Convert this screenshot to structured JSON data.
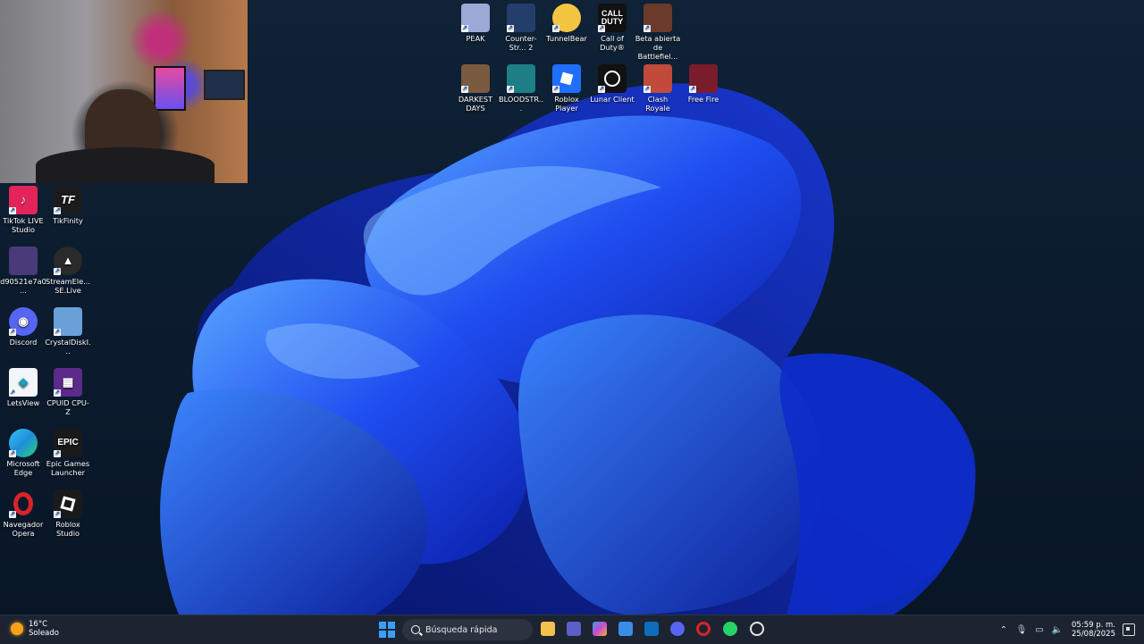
{
  "desktop_icons_top": [
    {
      "label": "PEAK",
      "icon": "peak-icon",
      "color": "#9aa9d6"
    },
    {
      "label": "Counter-Str... 2",
      "icon": "counter-strike-icon",
      "color": "#233e6b"
    },
    {
      "label": "TunnelBear",
      "icon": "tunnelbear-icon",
      "color": "#f4c542"
    },
    {
      "label": "Call of Duty®",
      "icon": "call-of-duty-icon",
      "color": "#111111"
    },
    {
      "label": "Beta abierta de Battlefiel...",
      "icon": "battlefield-icon",
      "color": "#6b3a2a"
    },
    {
      "label": "DARKEST DAYS",
      "icon": "darkest-days-icon",
      "color": "#7a5a40"
    },
    {
      "label": "BLOODSTR...",
      "icon": "bloodstrike-icon",
      "color": "#1d7f86"
    },
    {
      "label": "Roblox Player",
      "icon": "roblox-player-icon",
      "color": "#1f6fff"
    },
    {
      "label": "Lunar Client",
      "icon": "lunar-client-icon",
      "color": "#111111"
    },
    {
      "label": "Clash Royale",
      "icon": "clash-royale-icon",
      "color": "#c24a3a"
    },
    {
      "label": "Free Fire",
      "icon": "free-fire-icon",
      "color": "#7a1d2a"
    }
  ],
  "desktop_icons_left": [
    {
      "label": "TikTok LIVE Studio",
      "icon": "tiktok-live-icon",
      "color": "#e3245a"
    },
    {
      "label": "TikFinity",
      "icon": "tikfinity-icon",
      "color": "#1b1b1b"
    },
    {
      "label": "d90521e7a0...",
      "icon": "image-file-icon",
      "color": "#4a3a7a"
    },
    {
      "label": "StreamEle... SE.Live",
      "icon": "streamelements-icon",
      "color": "#2a2a2a"
    },
    {
      "label": "Discord",
      "icon": "discord-icon",
      "color": "#5865f2"
    },
    {
      "label": "CrystalDiskI...",
      "icon": "crystaldiskinfo-icon",
      "color": "#6aa0d8"
    },
    {
      "label": "LetsView",
      "icon": "letsview-icon",
      "color": "#f2f6fa"
    },
    {
      "label": "CPUID CPU-Z",
      "icon": "cpuz-icon",
      "color": "#5b2a8a"
    },
    {
      "label": "Microsoft Edge",
      "icon": "edge-icon",
      "color": "#1e8fd8"
    },
    {
      "label": "Epic Games Launcher",
      "icon": "epic-games-icon",
      "color": "#1a1a1a"
    },
    {
      "label": "Navegador Opera",
      "icon": "opera-icon",
      "color": "#d8232a"
    },
    {
      "label": "Roblox Studio",
      "icon": "roblox-studio-icon",
      "color": "#1a1a1a"
    }
  ],
  "icon_glyphs": {
    "call_of_duty": "CALL DUTY",
    "epic": "EPIC",
    "tikfinity": "TF"
  },
  "taskbar": {
    "weather_temp": "16°C",
    "weather_desc": "Soleado",
    "search_placeholder": "Búsqueda rápida",
    "time": "05:59 p. m.",
    "date": "25/08/2025",
    "apps": [
      {
        "icon": "file-explorer-icon",
        "color": "#f2c14e"
      },
      {
        "icon": "teams-icon",
        "color": "#5b5fc7"
      },
      {
        "icon": "copilot-icon",
        "color": "#35a0e8"
      },
      {
        "icon": "store-icon",
        "color": "#3a8ee6"
      },
      {
        "icon": "outlook-icon",
        "color": "#0f6cbd"
      },
      {
        "icon": "discord-icon",
        "color": "#5865f2"
      },
      {
        "icon": "opera-icon",
        "color": "#d8232a"
      },
      {
        "icon": "whatsapp-icon",
        "color": "#25d366"
      },
      {
        "icon": "chatgpt-icon",
        "color": "#2a2a2a"
      }
    ]
  }
}
